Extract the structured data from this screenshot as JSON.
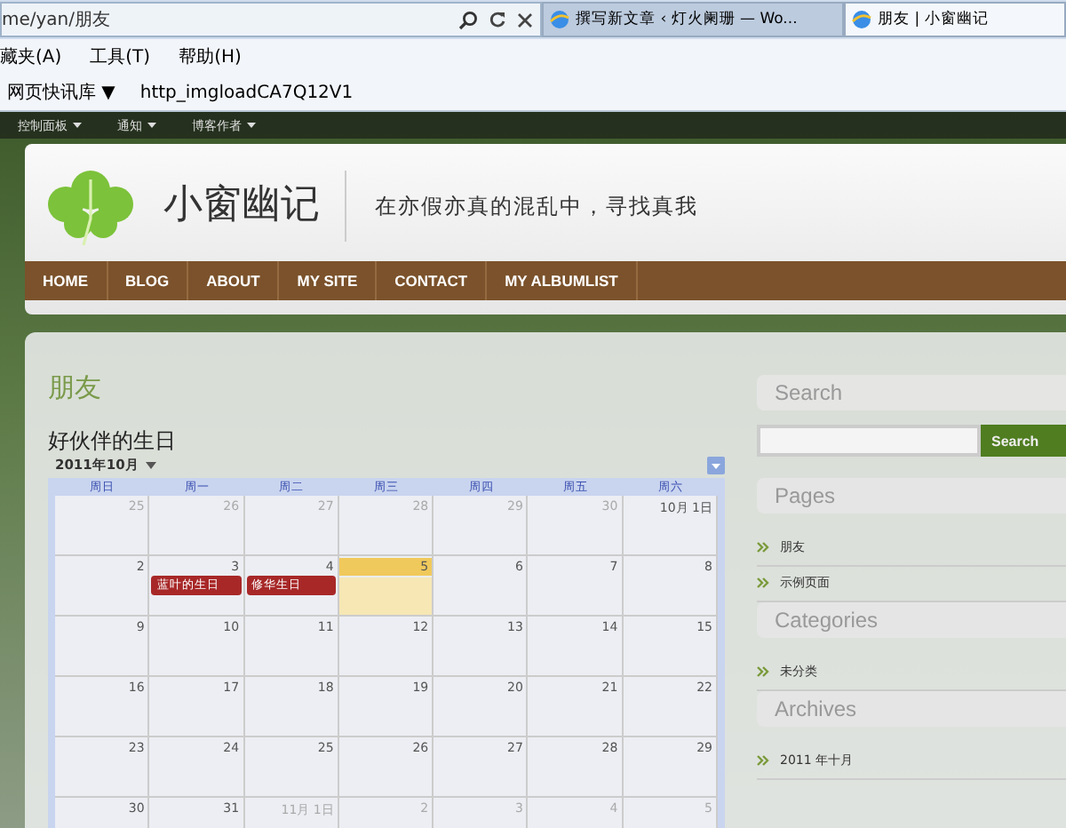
{
  "browser": {
    "address": "me/yan/朋友",
    "tabs": [
      {
        "label": "撰写新文章 ‹ 灯火阑珊 — Wo...",
        "selected": false
      },
      {
        "label": "朋友 | 小窗幽记",
        "selected": true
      }
    ],
    "menu": [
      "藏夹(A)",
      "工具(T)",
      "帮助(H)"
    ],
    "favorites": [
      {
        "label": "网页快讯库 ▼"
      },
      {
        "label": "http_imgloadCA7Q12V1"
      }
    ]
  },
  "admin_bar": [
    "控制面板",
    "通知",
    "博客作者"
  ],
  "site": {
    "title": "小窗幽记",
    "tagline": "在亦假亦真的混乱中，寻找真我"
  },
  "nav": [
    {
      "label": "HOME",
      "selected": false
    },
    {
      "label": "BLOG",
      "selected": false
    },
    {
      "label": "ABOUT",
      "selected": false
    },
    {
      "label": "MY SITE",
      "selected": false
    },
    {
      "label": "CONTACT",
      "selected": false
    },
    {
      "label": "MY ALBUMLIST",
      "selected": false
    }
  ],
  "page_title": "朋友",
  "calendar": {
    "title": "好伙伴的生日",
    "month": "2011年10月",
    "weekdays": [
      "周日",
      "周一",
      "周二",
      "周三",
      "周四",
      "周五",
      "周六"
    ],
    "weeks": [
      [
        {
          "day": "25",
          "muted": true
        },
        {
          "day": "26",
          "muted": true
        },
        {
          "day": "27",
          "muted": true
        },
        {
          "day": "28",
          "muted": true
        },
        {
          "day": "29",
          "muted": true
        },
        {
          "day": "30",
          "muted": true
        },
        {
          "day": "10月 1日",
          "muted": false
        }
      ],
      [
        {
          "day": "2",
          "muted": false
        },
        {
          "day": "3",
          "muted": false,
          "events": [
            "蓝叶的生日"
          ]
        },
        {
          "day": "4",
          "muted": false,
          "events": [
            "修华生日"
          ]
        },
        {
          "day": "5",
          "muted": false,
          "today": true
        },
        {
          "day": "6",
          "muted": false
        },
        {
          "day": "7",
          "muted": false
        },
        {
          "day": "8",
          "muted": false
        }
      ],
      [
        {
          "day": "9",
          "muted": false
        },
        {
          "day": "10",
          "muted": false
        },
        {
          "day": "11",
          "muted": false
        },
        {
          "day": "12",
          "muted": false
        },
        {
          "day": "13",
          "muted": false
        },
        {
          "day": "14",
          "muted": false
        },
        {
          "day": "15",
          "muted": false
        }
      ],
      [
        {
          "day": "16",
          "muted": false
        },
        {
          "day": "17",
          "muted": false
        },
        {
          "day": "18",
          "muted": false
        },
        {
          "day": "19",
          "muted": false
        },
        {
          "day": "20",
          "muted": false
        },
        {
          "day": "21",
          "muted": false
        },
        {
          "day": "22",
          "muted": false
        }
      ],
      [
        {
          "day": "23",
          "muted": false
        },
        {
          "day": "24",
          "muted": false
        },
        {
          "day": "25",
          "muted": false
        },
        {
          "day": "26",
          "muted": false
        },
        {
          "day": "27",
          "muted": false
        },
        {
          "day": "28",
          "muted": false
        },
        {
          "day": "29",
          "muted": false
        }
      ],
      [
        {
          "day": "30",
          "muted": false
        },
        {
          "day": "31",
          "muted": false
        },
        {
          "day": "11月 1日",
          "muted": true
        },
        {
          "day": "2",
          "muted": true
        },
        {
          "day": "3",
          "muted": true
        },
        {
          "day": "4",
          "muted": true
        },
        {
          "day": "5",
          "muted": true
        }
      ]
    ]
  },
  "sidebar": [
    {
      "kind": "search",
      "title": "Search",
      "button": "Search"
    },
    {
      "kind": "list",
      "title": "Pages",
      "items": [
        "朋友",
        "示例页面"
      ]
    },
    {
      "kind": "list",
      "title": "Categories",
      "items": [
        "未分类"
      ]
    },
    {
      "kind": "list",
      "title": "Archives",
      "items": [
        "2011 年十月"
      ]
    }
  ]
}
